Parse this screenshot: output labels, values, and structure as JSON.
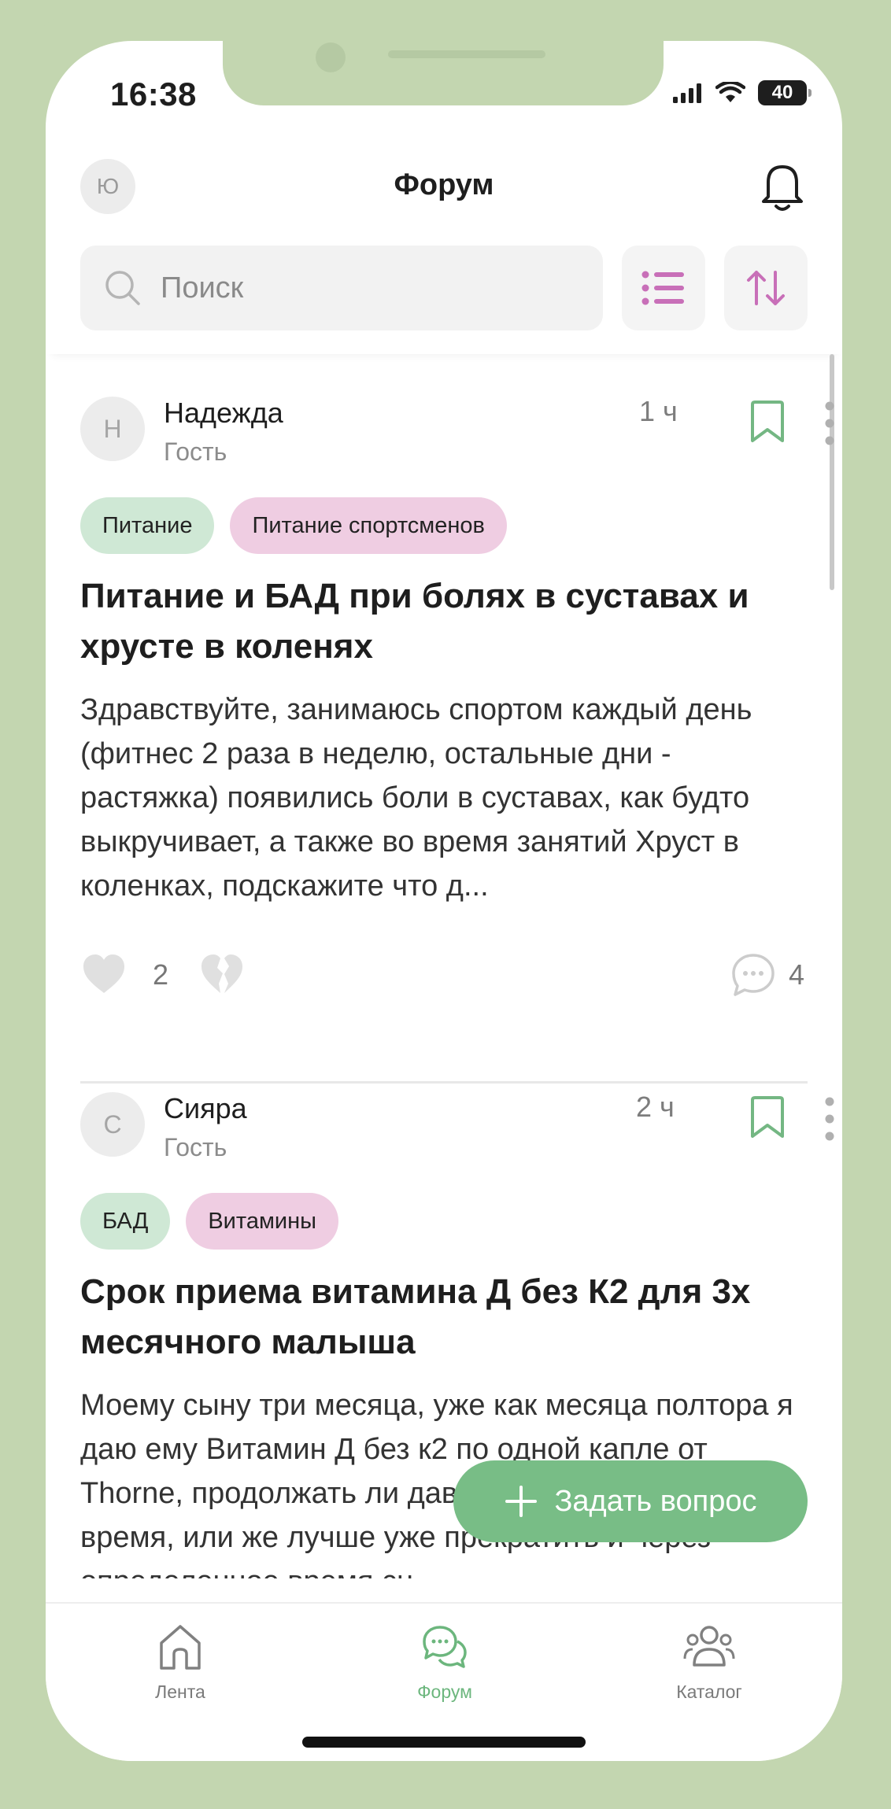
{
  "status": {
    "time": "16:38",
    "battery": "40"
  },
  "header": {
    "avatar_letter": "Ю",
    "title": "Форум"
  },
  "search": {
    "placeholder": "Поиск"
  },
  "posts": [
    {
      "avatar_letter": "Н",
      "author": "Надежда",
      "role": "Гость",
      "time": "1 ч",
      "tags": [
        {
          "label": "Питание",
          "color": "green"
        },
        {
          "label": "Питание спортсменов",
          "color": "pink"
        }
      ],
      "title": "Питание и БАД при болях в суставах и хрусте в коленях",
      "body": "Здравствуйте, занимаюсь спортом каждый день (фитнес 2 раза в неделю,  остальные дни - растяжка) появились боли в суставах, как будто выкручивает, а также во время занятий Хруст в коленках, подскажите что д...",
      "likes": "2",
      "comments": "4"
    },
    {
      "avatar_letter": "С",
      "author": "Сияра",
      "role": "Гость",
      "time": "2 ч",
      "tags": [
        {
          "label": "БАД",
          "color": "green"
        },
        {
          "label": "Витамины",
          "color": "pink"
        }
      ],
      "title": "Срок приема витамина Д без К2 для 3х месячного малыша",
      "body": "Моему сыну три месяца, уже как месяца полтора я даю ему Витамин Д без к2 по одной капле от Thorne, продолжать ли давать его, если да то какое время, или же лучше уже прекратить и через определенное время сн..."
    }
  ],
  "fab": {
    "label": "Задать вопрос"
  },
  "tabbar": {
    "items": [
      {
        "label": "Лента"
      },
      {
        "label": "Форум"
      },
      {
        "label": "Каталог"
      }
    ]
  },
  "colors": {
    "accent": "#78bd86",
    "frame": "#c3d6b0",
    "tag_green": "#cfe8d5",
    "tag_pink": "#efcde2",
    "filter_icon": "#c86fb8"
  }
}
